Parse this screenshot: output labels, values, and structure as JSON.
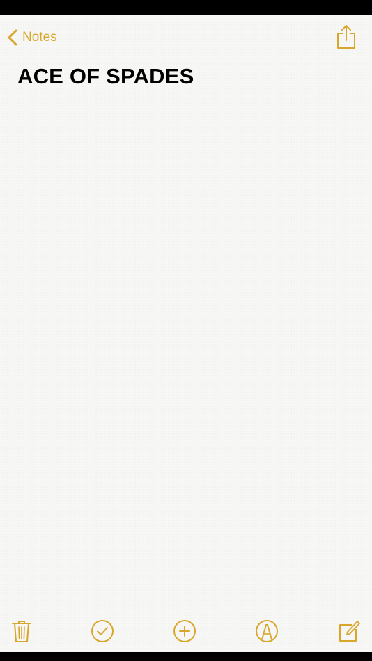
{
  "app": {
    "accent_color": "#d9a62c",
    "background_color": "#f7f7f5"
  },
  "nav": {
    "back_label": "Notes",
    "back_icon": "chevron-left-icon",
    "share_icon": "share-icon"
  },
  "note": {
    "title": "ACE OF SPADES"
  },
  "toolbar": {
    "items": [
      {
        "icon": "trash-icon"
      },
      {
        "icon": "checklist-icon"
      },
      {
        "icon": "add-icon"
      },
      {
        "icon": "markup-icon"
      },
      {
        "icon": "compose-icon"
      }
    ]
  }
}
